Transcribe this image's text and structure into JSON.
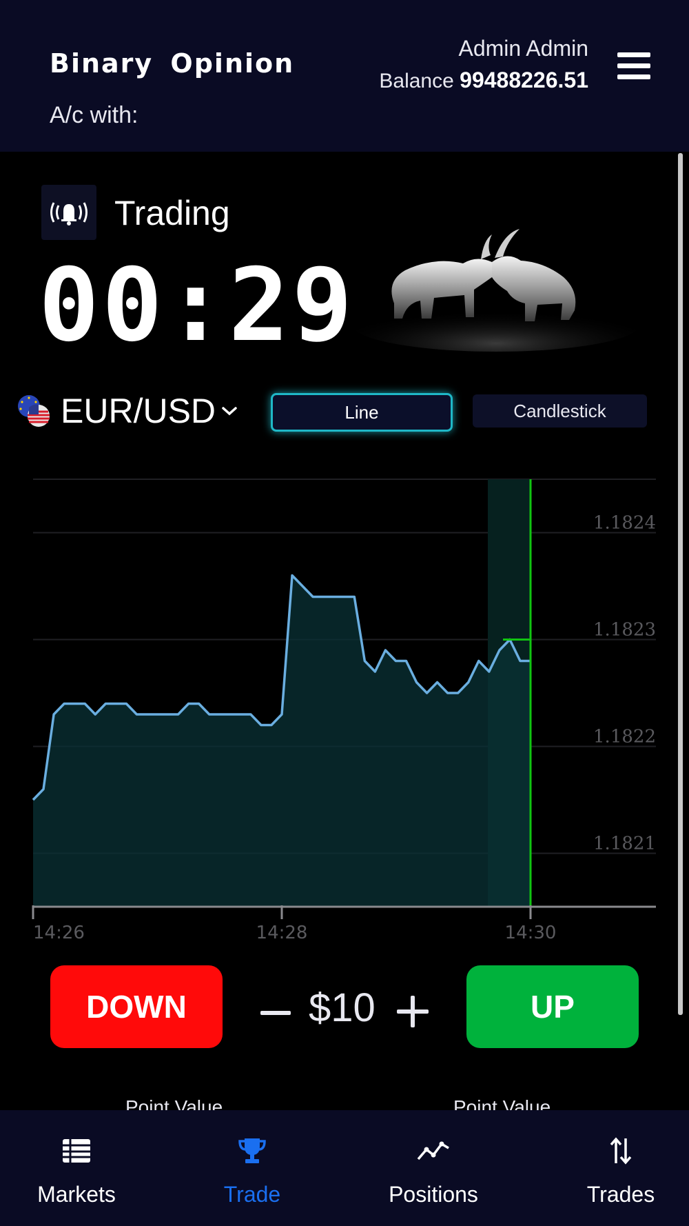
{
  "header": {
    "brand": "Binary Opinion",
    "account_label": "A/c with:",
    "user_name": "Admin Admin",
    "balance_label": "Balance",
    "balance_value": "99488226.51",
    "menu_icon": "hamburger-menu-icon"
  },
  "trade": {
    "status_icon": "ringing-bell-icon",
    "status_label": "Trading",
    "countdown": "00:29",
    "pair": "EUR/USD",
    "chart_types": [
      "Line",
      "Candlestick"
    ],
    "active_chart_type": "Line"
  },
  "chart_data": {
    "type": "line",
    "x_ticks": [
      "14:26",
      "14:28",
      "14:30"
    ],
    "y_ticks": [
      "1.1824",
      "1.1823",
      "1.1822",
      "1.1821"
    ],
    "ylim": [
      1.18205,
      1.18245
    ],
    "line_color": "#6aaee0",
    "fill_color": "#0a3236",
    "expiry_color": "#11c411",
    "x": [
      "14:26:00",
      "14:26:05",
      "14:26:10",
      "14:26:15",
      "14:26:20",
      "14:26:25",
      "14:26:30",
      "14:26:35",
      "14:26:40",
      "14:26:45",
      "14:26:50",
      "14:26:55",
      "14:27:00",
      "14:27:05",
      "14:27:10",
      "14:27:15",
      "14:27:20",
      "14:27:25",
      "14:27:30",
      "14:27:35",
      "14:27:40",
      "14:27:45",
      "14:27:50",
      "14:27:55",
      "14:28:00",
      "14:28:05",
      "14:28:10",
      "14:28:15",
      "14:28:20",
      "14:28:25",
      "14:28:30",
      "14:28:35",
      "14:28:40",
      "14:28:45",
      "14:28:50",
      "14:28:55",
      "14:29:00",
      "14:29:05",
      "14:29:10",
      "14:29:15",
      "14:29:20",
      "14:29:25",
      "14:29:30",
      "14:29:35",
      "14:29:40",
      "14:29:45",
      "14:29:50",
      "14:29:55",
      "14:30:00"
    ],
    "values": [
      1.18215,
      1.18216,
      1.18223,
      1.18224,
      1.18224,
      1.18224,
      1.18223,
      1.18224,
      1.18224,
      1.18224,
      1.18223,
      1.18223,
      1.18223,
      1.18223,
      1.18223,
      1.18224,
      1.18224,
      1.18223,
      1.18223,
      1.18223,
      1.18223,
      1.18223,
      1.18222,
      1.18222,
      1.18223,
      1.18236,
      1.18235,
      1.18234,
      1.18234,
      1.18234,
      1.18234,
      1.18234,
      1.18228,
      1.18227,
      1.18229,
      1.18228,
      1.18228,
      1.18226,
      1.18225,
      1.18226,
      1.18225,
      1.18225,
      1.18226,
      1.18228,
      1.18227,
      1.18229,
      1.1823,
      1.18228,
      1.18228
    ],
    "strike_price": 1.1823,
    "expiry_time": "14:30:00",
    "current_time": "14:29:34"
  },
  "actions": {
    "down_label": "DOWN",
    "up_label": "UP",
    "amount": "$10",
    "minus_icon": "minus-icon",
    "plus_icon": "plus-icon",
    "point_value_label": "Point Value"
  },
  "nav": {
    "items": [
      {
        "label": "Markets",
        "icon": "list-icon"
      },
      {
        "label": "Trade",
        "icon": "trophy-icon"
      },
      {
        "label": "Positions",
        "icon": "trend-chart-icon"
      },
      {
        "label": "Trades",
        "icon": "up-down-arrows-icon"
      }
    ],
    "active": "Trade",
    "active_color": "#1a6ff0"
  }
}
